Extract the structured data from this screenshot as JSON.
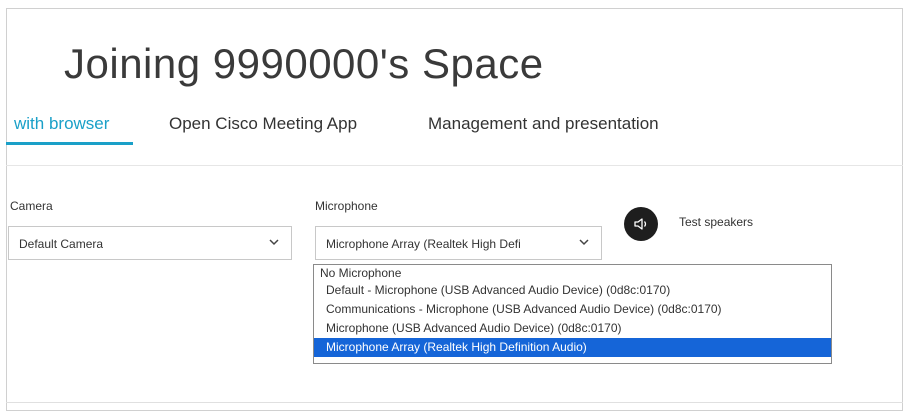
{
  "page": {
    "title": "Joining 9990000's Space"
  },
  "tabs": [
    {
      "label": "with browser",
      "active": true
    },
    {
      "label": "Open Cisco Meeting App",
      "active": false
    },
    {
      "label": "Management and presentation",
      "active": false
    }
  ],
  "camera": {
    "label": "Camera",
    "selected": "Default Camera",
    "icon": "chevron-down-icon"
  },
  "microphone": {
    "label": "Microphone",
    "selected": "Microphone Array (Realtek High Defi",
    "icon": "chevron-down-icon",
    "options": [
      "No Microphone",
      "Default - Microphone (USB Advanced Audio Device) (0d8c:0170)",
      "Communications - Microphone (USB Advanced Audio Device) (0d8c:0170)",
      "Microphone (USB Advanced Audio Device) (0d8c:0170)",
      "Microphone Array (Realtek High Definition Audio)"
    ],
    "highlighted_index": 4
  },
  "speakers": {
    "label": "Test speakers",
    "icon": "speaker-icon"
  },
  "colors": {
    "accent": "#1aa0c8",
    "selection": "#1565d8"
  }
}
